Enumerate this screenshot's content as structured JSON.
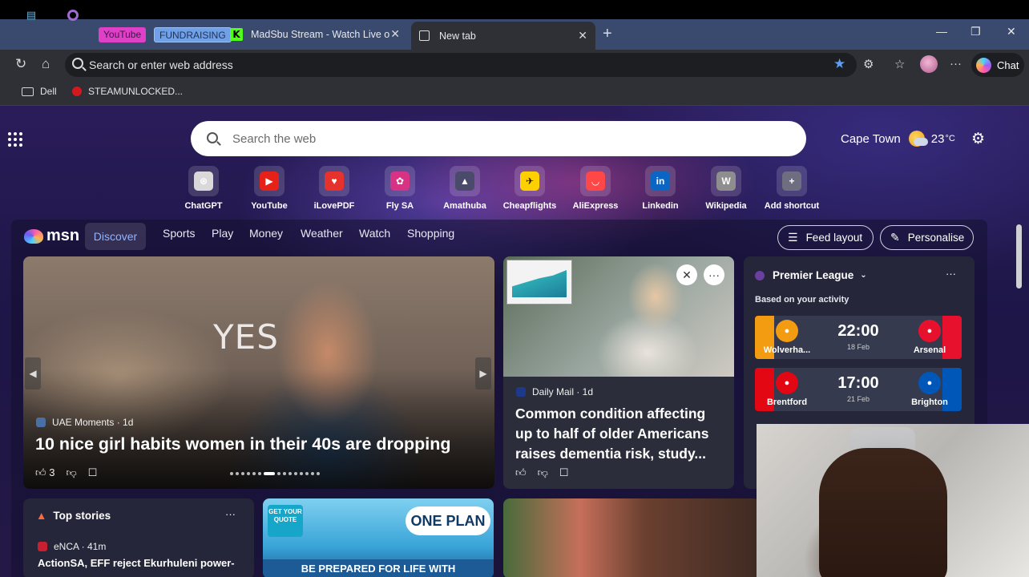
{
  "browser": {
    "tabs": [
      {
        "label": "YouTube"
      },
      {
        "label": "FUNDRAISING"
      },
      {
        "label": "MadSbu Stream - Watch Live on K"
      },
      {
        "label": "New tab"
      }
    ],
    "address_placeholder": "Search or enter web address",
    "chat_label": "Chat",
    "favorites": [
      {
        "label": "Dell"
      },
      {
        "label": "STEAMUNLOCKED..."
      }
    ]
  },
  "page": {
    "search_placeholder": "Search the web",
    "weather": {
      "city": "Cape Town",
      "temp": "23",
      "unit": "°C"
    },
    "shortcuts": [
      {
        "label": "ChatGPT",
        "icon": "chatgpt-icon",
        "color": "#d9d9d9",
        "glyph": "⊛"
      },
      {
        "label": "YouTube",
        "icon": "youtube-icon",
        "color": "#e62117",
        "glyph": "▶"
      },
      {
        "label": "iLovePDF",
        "icon": "ilovepdf-icon",
        "color": "#e5322d",
        "glyph": "♥"
      },
      {
        "label": "Fly SA",
        "icon": "flysa-icon",
        "color": "#d63384",
        "glyph": "✿"
      },
      {
        "label": "Amathuba",
        "icon": "amathuba-icon",
        "color": "#4a4a6a",
        "glyph": "▲"
      },
      {
        "label": "Cheapflights",
        "icon": "cheapflights-icon",
        "color": "#ffd000",
        "glyph": "✈"
      },
      {
        "label": "AliExpress",
        "icon": "aliexpress-icon",
        "color": "#ff4747",
        "glyph": "◡"
      },
      {
        "label": "Linkedin",
        "icon": "linkedin-icon",
        "color": "#0a66c2",
        "glyph": "in"
      },
      {
        "label": "Wikipedia",
        "icon": "wikipedia-icon",
        "color": "#8e8e8e",
        "glyph": "W"
      },
      {
        "label": "Add shortcut",
        "icon": "plus-icon",
        "color": "#6e6e80",
        "glyph": "+"
      }
    ]
  },
  "feed": {
    "brand": "msn",
    "tabs": [
      "Discover",
      "Sports",
      "Play",
      "Money",
      "Weather",
      "Watch",
      "Shopping"
    ],
    "feed_layout_label": "Feed layout",
    "personalise_label": "Personalise",
    "hero": {
      "overlay_text": "YES",
      "source": "UAE Moments · 1d",
      "headline": "10 nice girl habits women in their 40s are dropping",
      "likes": "3"
    },
    "story2": {
      "source": "Daily Mail · 1d",
      "headline": "Common condition affecting up to half of older Americans raises dementia risk, study..."
    },
    "sports": {
      "league": "Premier League",
      "subtitle": "Based on your activity",
      "matches": [
        {
          "home": "Wolverha...",
          "away": "Arsenal",
          "time": "22:00",
          "date": "18 Feb",
          "home_color": "#f39c12",
          "away_color": "#e8112d"
        },
        {
          "home": "Brentford",
          "away": "Brighton",
          "time": "17:00",
          "date": "21 Feb",
          "home_color": "#e30613",
          "away_color": "#0057b8"
        }
      ]
    },
    "top_stories": {
      "title": "Top stories",
      "source": "eNCA · 41m",
      "headline": "ActionSA, EFF reject Ekurhuleni power-"
    },
    "ad": {
      "badge": "GET YOUR QUOTE",
      "brand": "ONE PLAN",
      "tagline": "BE PREPARED FOR LIFE WITH"
    }
  }
}
